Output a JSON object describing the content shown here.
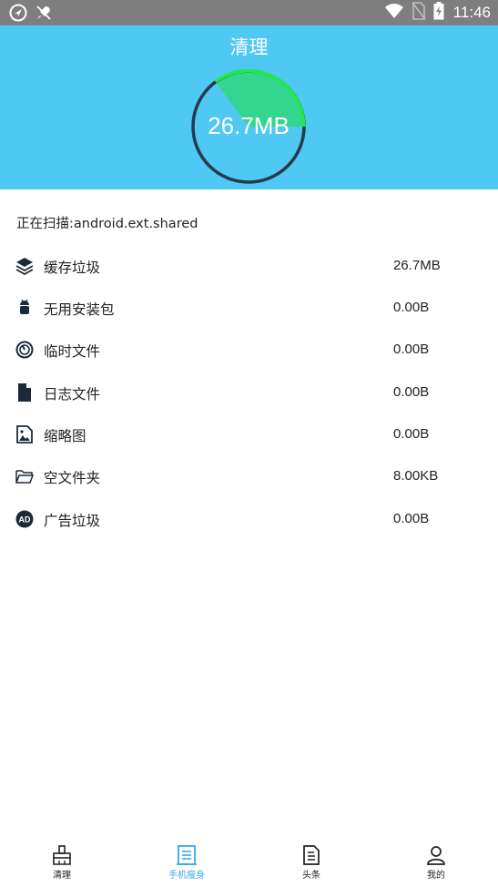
{
  "status_bar": {
    "time": "11:46"
  },
  "header": {
    "title": "清理",
    "size_text": "26.7MB",
    "bg_color": "#4fc9f3",
    "progress_color": "#2ee07e"
  },
  "scan": {
    "text": "正在扫描:android.ext.shared"
  },
  "items": [
    {
      "icon": "layers-icon",
      "label": "缓存垃圾",
      "value": "26.7MB"
    },
    {
      "icon": "android-icon",
      "label": "无用安装包",
      "value": "0.00B"
    },
    {
      "icon": "clock-icon",
      "label": "临时文件",
      "value": "0.00B"
    },
    {
      "icon": "file-icon",
      "label": "日志文件",
      "value": "0.00B"
    },
    {
      "icon": "image-icon",
      "label": "缩略图",
      "value": "0.00B"
    },
    {
      "icon": "folder-icon",
      "label": "空文件夹",
      "value": "8.00KB"
    },
    {
      "icon": "ad-icon",
      "label": "广告垃圾",
      "value": "0.00B"
    }
  ],
  "nav": {
    "active_color": "#3aa9e8",
    "items": [
      {
        "label": "清理",
        "icon": "broom-icon"
      },
      {
        "label": "手机瘦身",
        "icon": "document-list-icon"
      },
      {
        "label": "头条",
        "icon": "news-icon"
      },
      {
        "label": "我的",
        "icon": "person-icon"
      }
    ]
  }
}
